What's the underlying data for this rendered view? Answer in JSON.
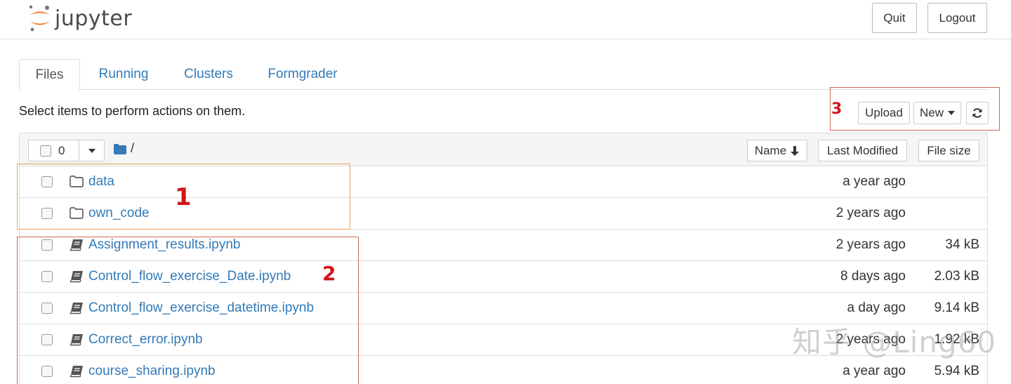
{
  "header": {
    "logo_text": "jupyter",
    "quit_label": "Quit",
    "logout_label": "Logout"
  },
  "tabs": [
    {
      "label": "Files",
      "active": true
    },
    {
      "label": "Running",
      "active": false
    },
    {
      "label": "Clusters",
      "active": false
    },
    {
      "label": "Formgrader",
      "active": false
    }
  ],
  "toolbar": {
    "hint": "Select items to perform actions on them.",
    "upload_label": "Upload",
    "new_label": "New"
  },
  "list_header": {
    "selected_count": "0",
    "path": "/",
    "col_name": "Name",
    "col_modified": "Last Modified",
    "col_size": "File size"
  },
  "files": [
    {
      "name": "data",
      "type": "folder",
      "modified": "a year ago",
      "size": ""
    },
    {
      "name": "own_code",
      "type": "folder",
      "modified": "2 years ago",
      "size": ""
    },
    {
      "name": "Assignment_results.ipynb",
      "type": "notebook",
      "modified": "2 years ago",
      "size": "34 kB"
    },
    {
      "name": "Control_flow_exercise_Date.ipynb",
      "type": "notebook",
      "modified": "8 days ago",
      "size": "2.03 kB"
    },
    {
      "name": "Control_flow_exercise_datetime.ipynb",
      "type": "notebook",
      "modified": "a day ago",
      "size": "9.14 kB"
    },
    {
      "name": "Correct_error.ipynb",
      "type": "notebook",
      "modified": "2 years ago",
      "size": "1.92 kB"
    },
    {
      "name": "course_sharing.ipynb",
      "type": "notebook",
      "modified": "a year ago",
      "size": "5.94 kB"
    }
  ],
  "annotations": {
    "n1": "1",
    "n2": "2",
    "n3": "3"
  },
  "watermark": "知乎 @Ling60",
  "colors": {
    "link": "#337ab7",
    "annotation_red": "#d0171a",
    "jupyter_orange": "#f37726"
  }
}
